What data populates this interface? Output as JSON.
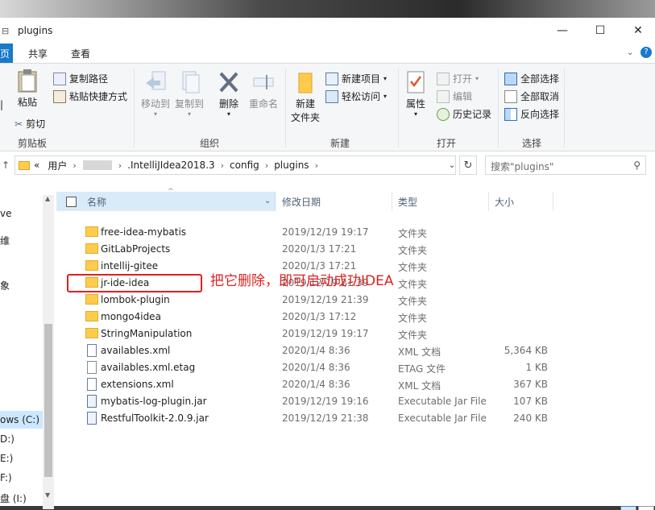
{
  "window": {
    "title": "plugins",
    "minimize_glyph": "—",
    "maximize_glyph": "☐",
    "close_glyph": "✕"
  },
  "tabs": [
    {
      "label": "页"
    },
    {
      "label": "共享"
    },
    {
      "label": "查看"
    }
  ],
  "ribbon": {
    "clipboard": {
      "paste_label": "粘贴",
      "copy_path_label": "复制路径",
      "paste_shortcut_label": "粘贴快捷方式",
      "cut_label": "剪切",
      "group_label": "剪贴板"
    },
    "organize": {
      "move_to_label": "移动到",
      "copy_to_label": "复制到",
      "delete_label": "删除",
      "rename_label": "重命名",
      "group_label": "组织"
    },
    "new": {
      "new_folder_label": "新建\n文件夹",
      "new_folder_line1": "新建",
      "new_folder_line2": "文件夹",
      "new_item_label": "新建项目",
      "easy_access_label": "轻松访问",
      "group_label": "新建"
    },
    "open": {
      "properties_label": "属性",
      "open_label": "打开",
      "edit_label": "编辑",
      "history_label": "历史记录",
      "group_label": "打开"
    },
    "select": {
      "select_all_label": "全部选择",
      "select_none_label": "全部取消",
      "invert_label": "反向选择",
      "group_label": "选择"
    }
  },
  "address": {
    "overflow": "«",
    "crumbs": [
      "用户",
      ".IntelliJIdea2018.3",
      "config",
      "plugins"
    ],
    "search_placeholder": "搜索\"plugins\""
  },
  "nav": {
    "items": [
      "ve",
      "维",
      "",
      "象",
      "ows (C:)",
      "D:)",
      "E:)",
      "F:)",
      "盘 (I:)"
    ]
  },
  "columns": {
    "name": "名称",
    "date": "修改日期",
    "type": "类型",
    "size": "大小"
  },
  "files": [
    {
      "name": "free-idea-mybatis",
      "date": "2019/12/19 19:17",
      "type": "文件夹",
      "size": "",
      "kind": "folder"
    },
    {
      "name": "GitLabProjects",
      "date": "2020/1/3 17:21",
      "type": "文件夹",
      "size": "",
      "kind": "folder"
    },
    {
      "name": "intellij-gitee",
      "date": "2020/1/3 17:21",
      "type": "文件夹",
      "size": "",
      "kind": "folder"
    },
    {
      "name": "jr-ide-idea",
      "date": "2019/12/19 21:39",
      "type": "文件夹",
      "size": "",
      "kind": "folder"
    },
    {
      "name": "lombok-plugin",
      "date": "2019/12/19 21:39",
      "type": "文件夹",
      "size": "",
      "kind": "folder"
    },
    {
      "name": "mongo4idea",
      "date": "2020/1/3 17:12",
      "type": "文件夹",
      "size": "",
      "kind": "folder"
    },
    {
      "name": "StringManipulation",
      "date": "2019/12/19 19:17",
      "type": "文件夹",
      "size": "",
      "kind": "folder"
    },
    {
      "name": "availables.xml",
      "date": "2020/1/4 8:36",
      "type": "XML 文档",
      "size": "5,364 KB",
      "kind": "xml"
    },
    {
      "name": "availables.xml.etag",
      "date": "2020/1/4 8:36",
      "type": "ETAG 文件",
      "size": "1 KB",
      "kind": "file"
    },
    {
      "name": "extensions.xml",
      "date": "2020/1/4 8:36",
      "type": "XML 文档",
      "size": "367 KB",
      "kind": "xml"
    },
    {
      "name": "mybatis-log-plugin.jar",
      "date": "2019/12/19 19:16",
      "type": "Executable Jar File",
      "size": "107 KB",
      "kind": "jar"
    },
    {
      "name": "RestfulToolkit-2.0.9.jar",
      "date": "2019/12/19 21:38",
      "type": "Executable Jar File",
      "size": "240 KB",
      "kind": "jar"
    }
  ],
  "annotation": {
    "text": "把它删除，即可启动成功IDEA"
  }
}
